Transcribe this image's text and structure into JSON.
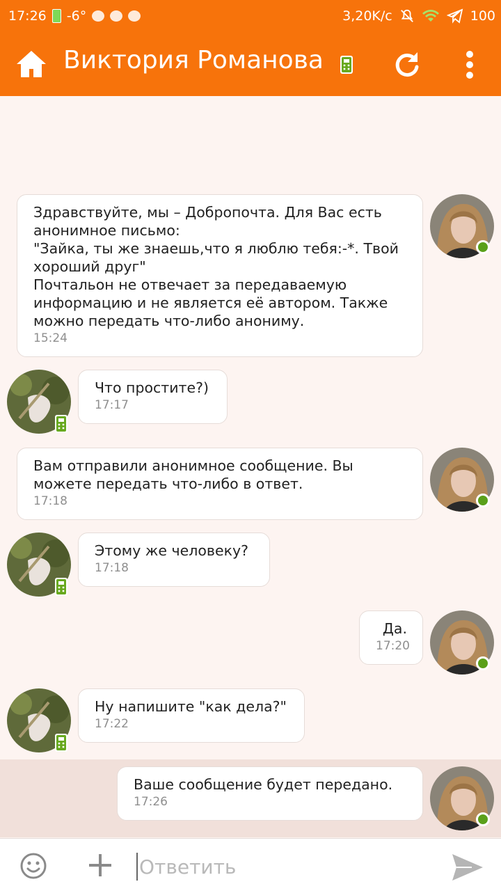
{
  "status_bar": {
    "time": "17:26",
    "temperature": "-6°",
    "net_speed": "3,20K/c",
    "battery": "100"
  },
  "header": {
    "title": "Виктория Романова"
  },
  "messages": [
    {
      "side": "right",
      "text": "Здравствуйте, мы – Добропочта. Для Вас есть анонимное письмо:\n\"Зайка, ты же знаешь,что я люблю тебя:-*. Твой хороший друг\"\nПочтальон не отвечает за передаваемую информацию и не является её автором. Также можно передать что-либо анониму.",
      "time": "15:24"
    },
    {
      "side": "left",
      "text": "Что простите?)",
      "time": "17:17"
    },
    {
      "side": "right",
      "text": "Вам отправили анонимное сообщение. Вы можете передать что-либо в ответ.",
      "time": "17:18"
    },
    {
      "side": "left",
      "text": "Этому же человеку?",
      "time": "17:18"
    },
    {
      "side": "right",
      "text": "Да.",
      "time": "17:20"
    },
    {
      "side": "left",
      "text": "Ну напишите \"как дела?\"",
      "time": "17:22"
    },
    {
      "side": "right",
      "text": "Ваше сообщение будет передано.",
      "time": "17:26"
    }
  ],
  "composer": {
    "placeholder": "Ответить"
  },
  "colors": {
    "accent": "#f7730b",
    "online": "#5aa01a",
    "background": "#fdf4f1"
  },
  "icons": [
    "home-icon",
    "mobile-icon",
    "refresh-icon",
    "more-vert-icon",
    "emoji-icon",
    "plus-icon",
    "send-icon"
  ]
}
